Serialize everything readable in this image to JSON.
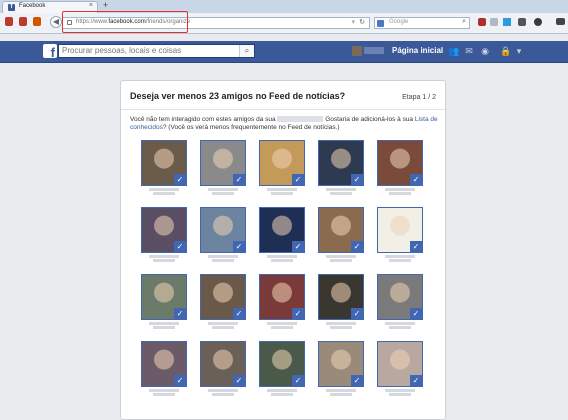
{
  "browser": {
    "tab_title": "Facebook",
    "tab_close": "×",
    "new_tab": "+",
    "url_prefix": "https://www.",
    "url_domain": "facebook.com",
    "url_path": "/friends/organize",
    "search_placeholder": "Google",
    "search_icon": "search-icon",
    "reload_icon": "reload-icon"
  },
  "facebook": {
    "logo": "f",
    "search_placeholder": "Procurar pessoas, locais e coisas",
    "home_label": "Página inicial"
  },
  "dialog": {
    "title": "Deseja ver menos 23 amigos no Feed de notícias?",
    "step": "Etapa 1 / 2",
    "desc_part1": "Você não tem interagido com estes amigos da sua",
    "desc_part2": "Gostaria de adicioná-los à sua",
    "desc_link": "Lista de conhecidos",
    "desc_part3": "? (Você os verá menos frequentemente no Feed de notícias.)",
    "check_glyph": "✓"
  },
  "friends": [
    {
      "color": "#6b5b4a"
    },
    {
      "color": "#8a8a8a"
    },
    {
      "color": "#c49a5a"
    },
    {
      "color": "#2e3a4f"
    },
    {
      "color": "#7a4a3a"
    },
    {
      "color": "#5a4e64"
    },
    {
      "color": "#6c84a0"
    },
    {
      "color": "#1f2e55"
    },
    {
      "color": "#8a6b50"
    },
    {
      "color": "#f1efe6"
    },
    {
      "color": "#6c7a6a"
    },
    {
      "color": "#6a5848"
    },
    {
      "color": "#7a3a3a"
    },
    {
      "color": "#3a3630"
    },
    {
      "color": "#7a7a7a"
    },
    {
      "color": "#6b5a68"
    },
    {
      "color": "#6a6058"
    },
    {
      "color": "#4a5a4a"
    },
    {
      "color": "#9a8a7a"
    },
    {
      "color": "#b8a8a0"
    }
  ]
}
